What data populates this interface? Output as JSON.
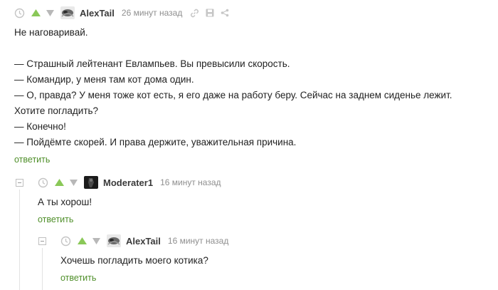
{
  "comments": [
    {
      "author": "AlexTail",
      "time": "26 минут назад",
      "lines": [
        "Не наговаривай.",
        "",
        "— Страшный лейтенант Евлампьев. Вы превысили скорость.",
        "— Командир, у меня там кот дома один.",
        "— О, правда? У меня тоже кот есть, я его даже на работу беру. Сейчас на заднем сиденье лежит.",
        "Хотите погладить?",
        "— Конечно!",
        "— Пойдёмте скорей. И права держите, уважительная причина."
      ],
      "reply_label": "ответить"
    },
    {
      "author": "Moderater1",
      "time": "16 минут назад",
      "lines": [
        "А ты хорош!"
      ],
      "reply_label": "ответить"
    },
    {
      "author": "AlexTail",
      "time": "16 минут назад",
      "lines": [
        "Хочешь погладить моего котика?"
      ],
      "reply_label": "ответить"
    }
  ],
  "icons": {
    "clock": "clock-icon",
    "upvote": "upvote-icon",
    "downvote": "downvote-icon",
    "link": "link-icon",
    "save": "save-icon",
    "share": "share-icon",
    "collapse": "collapse-icon"
  },
  "colors": {
    "upvote": "#8ac858",
    "downvote": "#b8b8b8",
    "reply": "#4f8f2a",
    "author": "#3a3a3a",
    "time": "#8f8f8f"
  }
}
